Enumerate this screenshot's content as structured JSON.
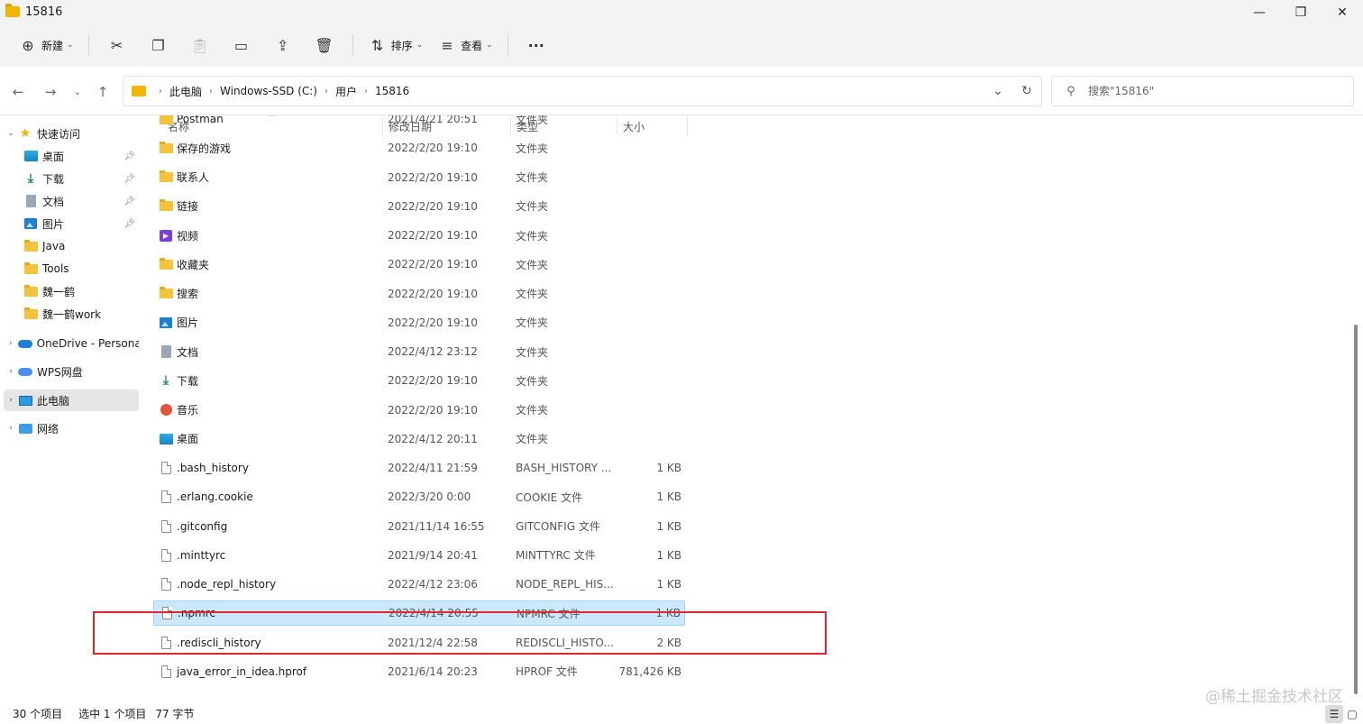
{
  "window": {
    "title": "15816",
    "controls": {
      "minimize": "—",
      "maximize": "❐",
      "close": "✕"
    }
  },
  "commandbar": {
    "new_label": "新建",
    "sort_label": "排序",
    "view_label": "查看",
    "more": "···"
  },
  "address": {
    "crumbs": [
      "此电脑",
      "Windows-SSD (C:)",
      "用户",
      "15816"
    ]
  },
  "search": {
    "placeholder": "搜索\"15816\""
  },
  "sidebar": {
    "quick_access": "快速访问",
    "items": [
      {
        "label": "桌面",
        "icon": "desktop-icon",
        "pinned": true
      },
      {
        "label": "下载",
        "icon": "download-icon",
        "pinned": true
      },
      {
        "label": "文档",
        "icon": "document-icon",
        "pinned": true
      },
      {
        "label": "图片",
        "icon": "pictures-icon",
        "pinned": true
      },
      {
        "label": "Java",
        "icon": "folder-icon",
        "pinned": false
      },
      {
        "label": "Tools",
        "icon": "folder-icon",
        "pinned": false
      },
      {
        "label": "魏一鹤",
        "icon": "folder-icon",
        "pinned": false
      },
      {
        "label": "魏一鹤work",
        "icon": "folder-icon",
        "pinned": false
      }
    ],
    "onedrive": "OneDrive - Persona",
    "wps": "WPS网盘",
    "this_pc": "此电脑",
    "network": "网络"
  },
  "columns": {
    "name": "名称",
    "date": "修改日期",
    "type": "类型",
    "size": "大小"
  },
  "files": [
    {
      "name": "Postman",
      "date": "2021/4/21 20:51",
      "type": "文件夹",
      "size": "",
      "icon": "folder-icon"
    },
    {
      "name": "保存的游戏",
      "date": "2022/2/20 19:10",
      "type": "文件夹",
      "size": "",
      "icon": "folder-icon"
    },
    {
      "name": "联系人",
      "date": "2022/2/20 19:10",
      "type": "文件夹",
      "size": "",
      "icon": "folder-icon"
    },
    {
      "name": "链接",
      "date": "2022/2/20 19:10",
      "type": "文件夹",
      "size": "",
      "icon": "folder-icon"
    },
    {
      "name": "视频",
      "date": "2022/2/20 19:10",
      "type": "文件夹",
      "size": "",
      "icon": "video-icon"
    },
    {
      "name": "收藏夹",
      "date": "2022/2/20 19:10",
      "type": "文件夹",
      "size": "",
      "icon": "folder-icon"
    },
    {
      "name": "搜索",
      "date": "2022/2/20 19:10",
      "type": "文件夹",
      "size": "",
      "icon": "folder-icon"
    },
    {
      "name": "图片",
      "date": "2022/2/20 19:10",
      "type": "文件夹",
      "size": "",
      "icon": "pictures-icon"
    },
    {
      "name": "文档",
      "date": "2022/4/12 23:12",
      "type": "文件夹",
      "size": "",
      "icon": "document-icon"
    },
    {
      "name": "下载",
      "date": "2022/2/20 19:10",
      "type": "文件夹",
      "size": "",
      "icon": "download-icon"
    },
    {
      "name": "音乐",
      "date": "2022/2/20 19:10",
      "type": "文件夹",
      "size": "",
      "icon": "music-icon"
    },
    {
      "name": "桌面",
      "date": "2022/4/12 20:11",
      "type": "文件夹",
      "size": "",
      "icon": "desktop-icon"
    },
    {
      "name": ".bash_history",
      "date": "2022/4/11 21:59",
      "type": "BASH_HISTORY ...",
      "size": "1 KB",
      "icon": "file-icon"
    },
    {
      "name": ".erlang.cookie",
      "date": "2022/3/20 0:00",
      "type": "COOKIE 文件",
      "size": "1 KB",
      "icon": "file-icon"
    },
    {
      "name": ".gitconfig",
      "date": "2021/11/14 16:55",
      "type": "GITCONFIG 文件",
      "size": "1 KB",
      "icon": "file-icon"
    },
    {
      "name": ".minttyrc",
      "date": "2021/9/14 20:41",
      "type": "MINTTYRC 文件",
      "size": "1 KB",
      "icon": "file-icon"
    },
    {
      "name": ".node_repl_history",
      "date": "2022/4/12 23:06",
      "type": "NODE_REPL_HIS...",
      "size": "1 KB",
      "icon": "file-icon"
    },
    {
      "name": ".npmrc",
      "date": "2022/4/14 20:55",
      "type": "NPMRC 文件",
      "size": "1 KB",
      "icon": "file-icon",
      "selected": true
    },
    {
      "name": ".rediscli_history",
      "date": "2021/12/4 22:58",
      "type": "REDISCLI_HISTO...",
      "size": "2 KB",
      "icon": "file-icon"
    },
    {
      "name": "java_error_in_idea.hprof",
      "date": "2021/6/14 20:23",
      "type": "HPROF 文件",
      "size": "781,426 KB",
      "icon": "file-icon"
    }
  ],
  "status": {
    "count": "30 个项目",
    "selected": "选中 1 个项目",
    "size": "77 字节"
  },
  "watermark": "@稀土掘金技术社区",
  "colors": {
    "selection": "#cce8ff",
    "highlight_box": "#e0262e",
    "folder": "#f5c33b"
  }
}
